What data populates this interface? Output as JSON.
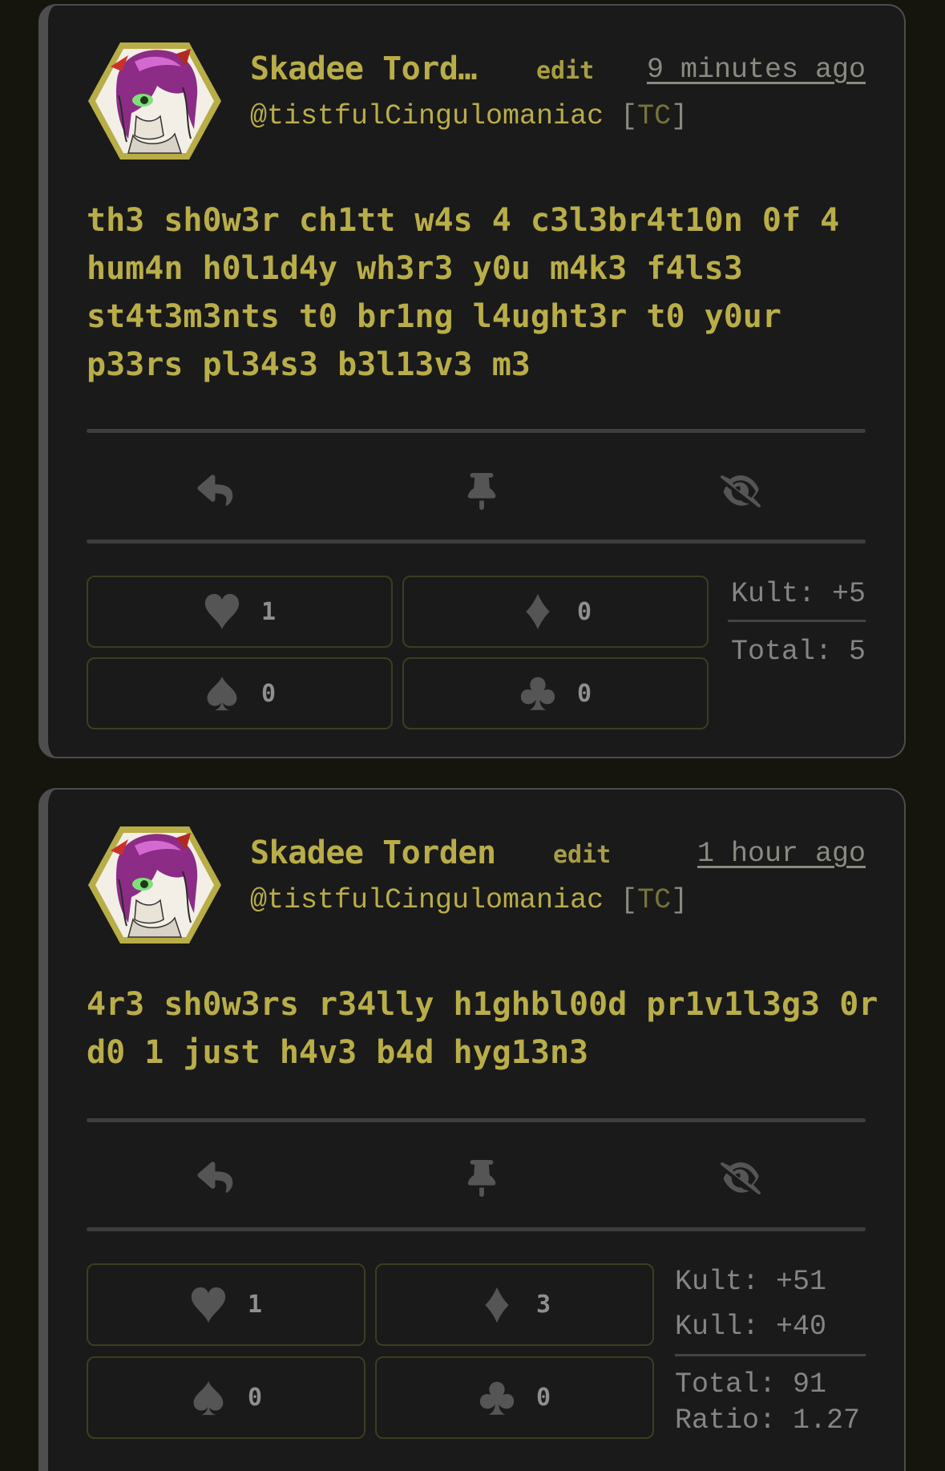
{
  "posts": [
    {
      "display_name": "Skadee Tord…",
      "edit_label": "edit",
      "timestamp": "9 minutes ago",
      "handle": "@tistfulCingulomaniac",
      "handle_tag": "TC",
      "text": "th3 sh0w3r ch1tt w4s 4 c3l3br4t10n 0f 4 hum4n h0l1d4y wh3r3 y0u m4k3 f4ls3 st4t3m3nts t0 br1ng l4ught3r t0 y0ur p33rs pl34s3 b3l13v3 m3",
      "reactions": {
        "heart": "1",
        "diamond": "0",
        "spade": "0",
        "club": "0"
      },
      "stats": [
        "Kult: +5"
      ],
      "totals": [
        "Total: 5"
      ]
    },
    {
      "display_name": "Skadee Torden",
      "edit_label": "edit",
      "timestamp": "1 hour ago",
      "handle": "@tistfulCingulomaniac",
      "handle_tag": "TC",
      "text": "4r3 sh0w3rs r34lly h1ghbl00d pr1v1l3g3 0r d0 1 just h4v3 b4d hyg13n3",
      "reactions": {
        "heart": "1",
        "diamond": "3",
        "spade": "0",
        "club": "0"
      },
      "stats": [
        "Kult: +51",
        "Kull: +40"
      ],
      "totals": [
        "Total: 91",
        "Ratio: 1.27"
      ]
    }
  ],
  "icons": {
    "reply": "reply-icon",
    "pin": "pin-icon",
    "hide": "eye-slash-icon",
    "heart": "heart-suit-icon",
    "diamond": "diamond-suit-icon",
    "spade": "spade-suit-icon",
    "club": "club-suit-icon"
  },
  "colors": {
    "page_background": "#15150d",
    "card_background": "#1a1a1a",
    "accent_text": "#b9ad49",
    "muted_text": "#858585",
    "icon_gray": "#555555"
  }
}
